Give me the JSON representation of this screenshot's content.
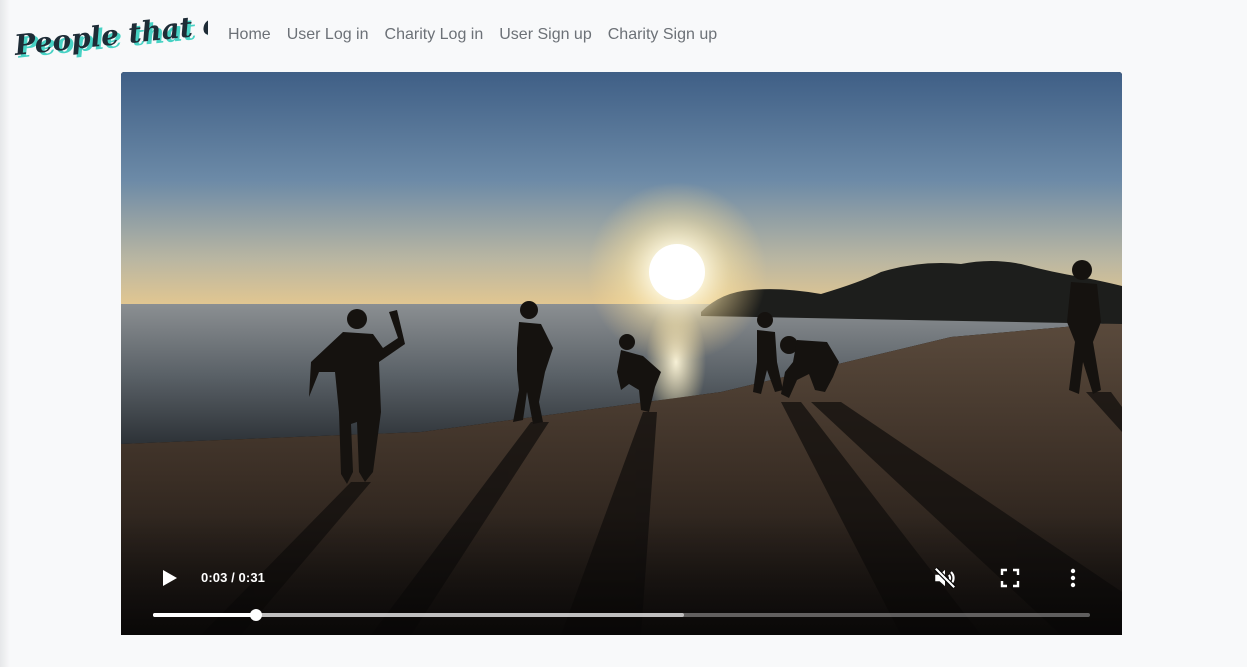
{
  "brand": {
    "name": "People that care",
    "text_color": "#1e2c36",
    "shadow_color": "#47d2c4"
  },
  "nav": {
    "items": [
      {
        "label": "Home"
      },
      {
        "label": "User Log in"
      },
      {
        "label": "Charity Log in"
      },
      {
        "label": "User Sign up"
      },
      {
        "label": "Charity Sign up"
      }
    ]
  },
  "video": {
    "time_display": "0:03 / 0:31",
    "played_fraction": 0.11,
    "buffered_fraction": 0.567,
    "muted": true,
    "icons": {
      "play": "play-icon",
      "mute": "volume-muted-icon",
      "fullscreen": "fullscreen-icon",
      "more": "more-vertical-icon"
    }
  }
}
